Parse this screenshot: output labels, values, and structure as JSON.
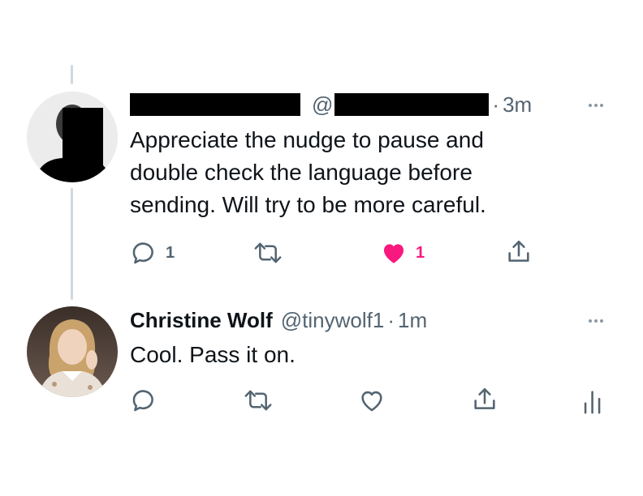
{
  "tweet1": {
    "handle_prefix": "@",
    "time": "3m",
    "text_lines": [
      "Appreciate the nudge to pause and",
      "double check the language before",
      "sending. Will try to be more careful."
    ],
    "actions": {
      "reply_count": "1",
      "like_count": "1"
    }
  },
  "tweet2": {
    "name": "Christine Wolf",
    "handle": "@tinywolf1",
    "time": "1m",
    "text": "Cool. Pass it on."
  },
  "colors": {
    "text": "#0f1419",
    "muted": "#536471",
    "like": "#f91880",
    "thread_line": "#cfd9de"
  },
  "icons": [
    "reply-icon",
    "retweet-icon",
    "like-icon",
    "share-icon",
    "analytics-icon",
    "more-icon"
  ]
}
